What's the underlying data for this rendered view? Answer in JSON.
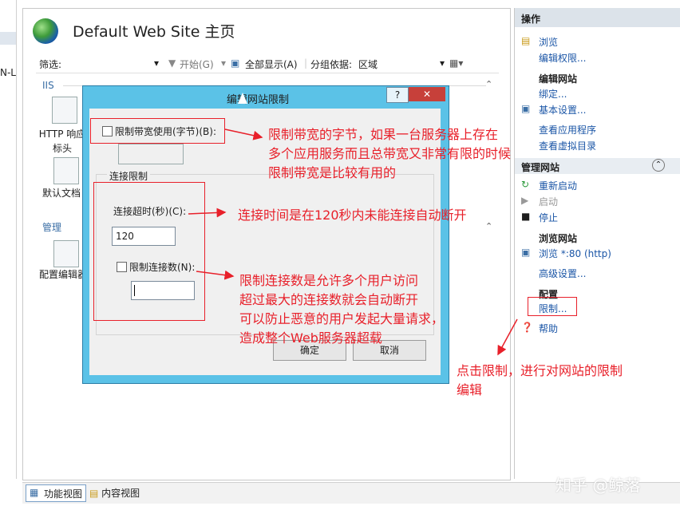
{
  "left_strip": {
    "text": "N-L"
  },
  "header": {
    "title": "Default Web Site 主页"
  },
  "filter_bar": {
    "filter_label": "筛选:",
    "start": "开始(G)",
    "show_all": "全部显示(A)",
    "group_by_label": "分组依据:",
    "group_by_value": "区域"
  },
  "groups": {
    "iis": "IIS",
    "management": "管理"
  },
  "features": {
    "http_response": "HTTP 响应标头",
    "default_doc": "默认文档",
    "config_editor": "配置编辑器"
  },
  "actions": {
    "header": "操作",
    "browse": "浏览",
    "edit_permissions": "编辑权限...",
    "edit_site": "编辑网站",
    "bindings": "绑定...",
    "basic_settings": "基本设置...",
    "view_apps": "查看应用程序",
    "view_vdirs": "查看虚拟目录",
    "manage_site": "管理网站",
    "restart": "重新启动",
    "start": "启动",
    "stop": "停止",
    "browse_site": "浏览网站",
    "browse_80": "浏览 *:80 (http)",
    "advanced_settings": "高级设置...",
    "config": "配置",
    "limits": "限制...",
    "help": "帮助"
  },
  "bottom_tabs": {
    "feature_view": "功能视图",
    "content_view": "内容视图"
  },
  "dialog": {
    "title": "编辑网站限制",
    "help": "?",
    "close": "✕",
    "limit_bandwidth": "限制带宽使用(字节)(B):",
    "connection_group": "连接限制",
    "timeout_label": "连接超时(秒)(C):",
    "timeout_value": "120",
    "limit_connections": "限制连接数(N):",
    "ok": "确定",
    "cancel": "取消"
  },
  "annotations": {
    "bandwidth_note": "限制带宽的字节，如果一台服务器上存在\n多个应用服务而且总带宽又非常有限的时候\n限制带宽是比较有用的",
    "timeout_note": "连接时间是在120秒内未能连接自动断开",
    "connections_note": "限制连接数是允许多个用户访问\n超过最大的连接数就会自动断开\n可以防止恶意的用户发起大量请求，\n造成整个Web服务器超载",
    "limit_click_note": "点击限制，进行对网站的限制\n编辑"
  },
  "watermark": "知乎 @鲸落",
  "colors": {
    "annotation_red": "#e8202a",
    "dialog_frame": "#5bc2e7",
    "link_blue": "#1a55a6"
  }
}
